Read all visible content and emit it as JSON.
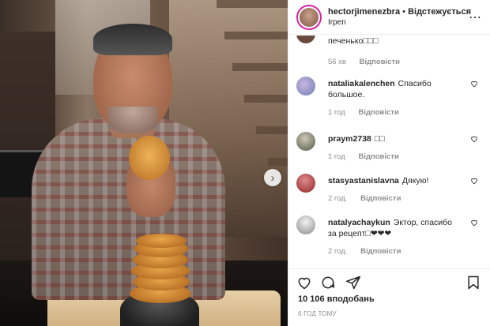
{
  "header": {
    "username": "hectorjimenezbra",
    "separator": "•",
    "follow_label": "Відстежується",
    "location": "Irpen",
    "more_icon": "more-options-icon"
  },
  "comments": [
    {
      "user": "",
      "text": "печенько\u0000\u0000\u0000",
      "time": "56 хв",
      "reply": "Відповісти",
      "avatar_color": "#6a4a3c"
    },
    {
      "user": "nataliakalenchen",
      "text": "Спасибо большое.",
      "time": "1 год",
      "reply": "Відповісти",
      "avatar_color": "#8a9ac0"
    },
    {
      "user": "praym2738",
      "text": "\u0000\u0000",
      "time": "1 год",
      "reply": "Відповісти",
      "avatar_color": "#6e7a62"
    },
    {
      "user": "stasyastanislavna",
      "text": "Дякую!",
      "time": "2 год.",
      "reply": "Відповісти",
      "avatar_color": "#a23a3a"
    },
    {
      "user": "natalyachaykun",
      "text": "Эктор, спасибо за рецепт\u0000❤❤❤",
      "time": "2 год.",
      "reply": "Відповісти",
      "avatar_color": "#bdbdbd"
    }
  ],
  "actions": {
    "like_icon": "heart-icon",
    "comment_icon": "comment-icon",
    "share_icon": "share-icon",
    "save_icon": "bookmark-icon"
  },
  "likes_text": "10 106 вподобань",
  "timestamp": "6 год тому",
  "colors": {
    "text": "#262626",
    "muted": "#8e8e8e",
    "border": "#efefef",
    "story_ring": "#d6249f"
  }
}
